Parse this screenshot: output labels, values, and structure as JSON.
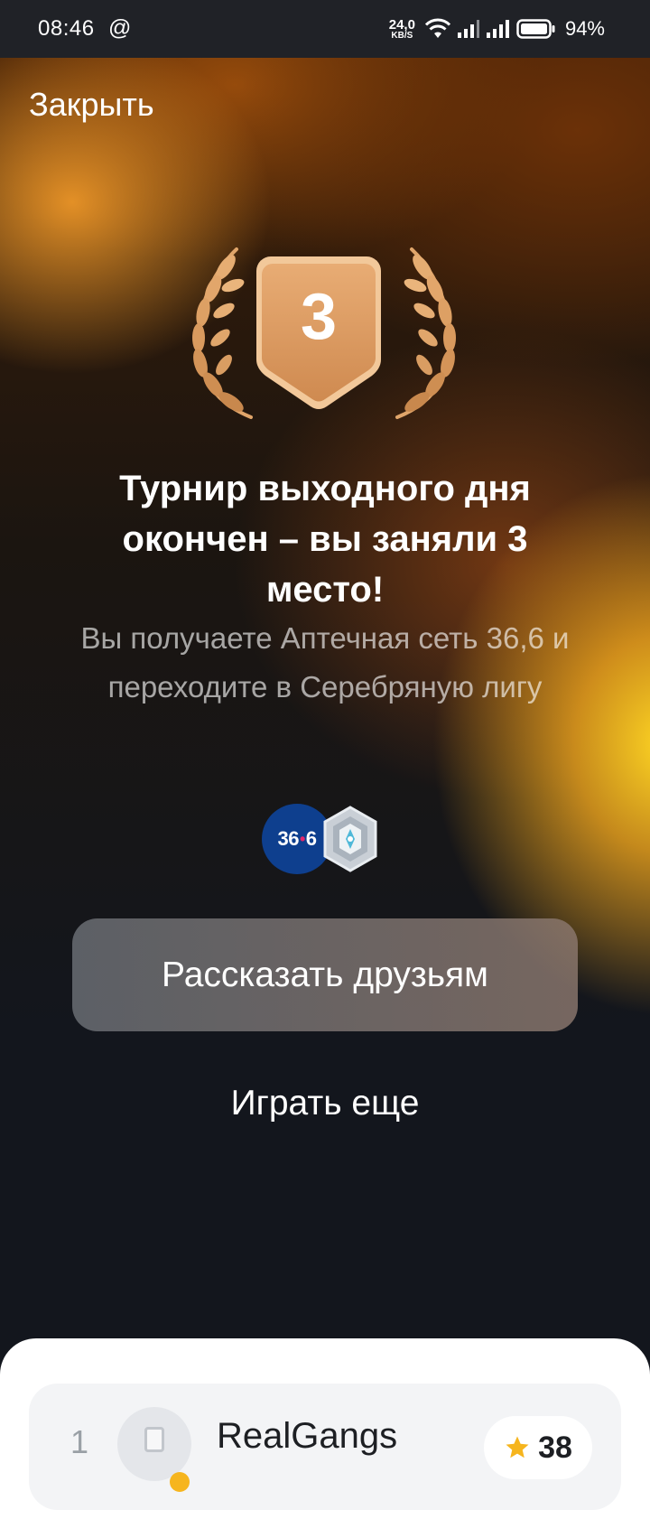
{
  "status_bar": {
    "time": "08:46",
    "at_symbol": "@",
    "net_speed_value": "24,0",
    "net_speed_unit": "KB/S",
    "battery_percent": "94%"
  },
  "header": {
    "close_label": "Закрыть"
  },
  "result": {
    "place_number": "3",
    "title": "Турнир выходного дня окончен – вы заняли 3 место!",
    "subtitle": "Вы получаете Аптечная сеть 36,6 и переходите в Серебряную лигу"
  },
  "rewards": {
    "pharmacy_logo_left": "36",
    "pharmacy_logo_dot": "•",
    "pharmacy_logo_right": "6",
    "league_icon": "silver-league-icon"
  },
  "actions": {
    "share_label": "Рассказать друзьям",
    "play_again_label": "Играть еще"
  },
  "leaderboard": {
    "rows": [
      {
        "rank": "1",
        "name": "RealGangs",
        "score": "38"
      }
    ]
  },
  "colors": {
    "background_dark": "#13161d",
    "status_bar": "#202227",
    "badge_bronze": "#d9955a",
    "accent_gold": "#ffd623",
    "pharmacy_blue": "#0e3f8e",
    "pharmacy_pink": "#e3266b",
    "star": "#f6b51e"
  }
}
